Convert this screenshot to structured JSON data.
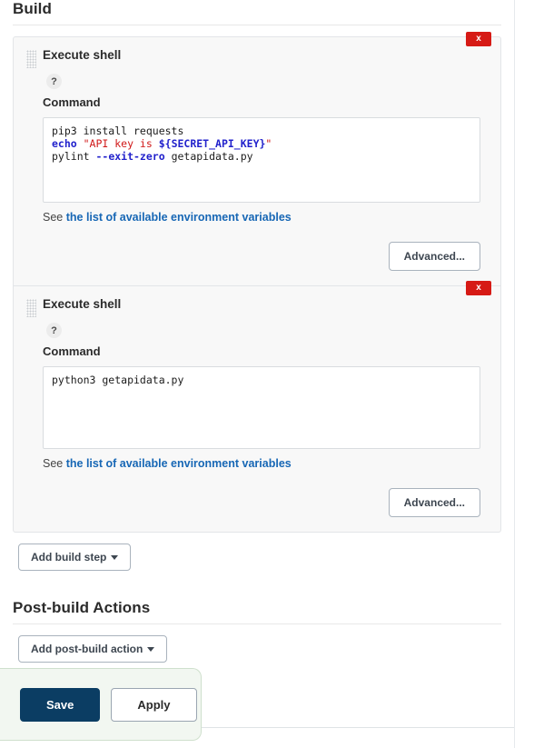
{
  "build_section": {
    "heading": "Build",
    "steps": [
      {
        "title": "Execute shell",
        "help_icon_label": "?",
        "delete_label": "x",
        "command_label": "Command",
        "command_lines": [
          [
            {
              "text": "pip3 install requests",
              "type": "plain"
            }
          ],
          [
            {
              "text": "echo ",
              "type": "keyword"
            },
            {
              "text": "\"API key is ",
              "type": "string"
            },
            {
              "text": "${SECRET_API_KEY}",
              "type": "variable"
            },
            {
              "text": "\"",
              "type": "string"
            }
          ],
          [
            {
              "text": "pylint ",
              "type": "plain"
            },
            {
              "text": "--exit-zero",
              "type": "flag"
            },
            {
              "text": " getapidata.py",
              "type": "plain"
            }
          ]
        ],
        "see_prefix": "See ",
        "see_link": "the list of available environment variables",
        "advanced_label": "Advanced..."
      },
      {
        "title": "Execute shell",
        "help_icon_label": "?",
        "delete_label": "x",
        "command_label": "Command",
        "command_lines": [
          [
            {
              "text": "python3 getapidata.py",
              "type": "plain"
            }
          ]
        ],
        "see_prefix": "See ",
        "see_link": "the list of available environment variables",
        "advanced_label": "Advanced..."
      }
    ],
    "add_build_step_label": "Add build step"
  },
  "postbuild_section": {
    "heading": "Post-build Actions",
    "add_postbuild_label": "Add post-build action"
  },
  "footer": {
    "save_label": "Save",
    "apply_label": "Apply"
  },
  "colors": {
    "delete_red": "#d61a15",
    "link_blue": "#1767b5",
    "save_navy": "#0b3d63",
    "footer_green_bg": "#f2f7f1",
    "code_keyword_blue": "#2222cc",
    "code_string_red": "#d01818"
  }
}
